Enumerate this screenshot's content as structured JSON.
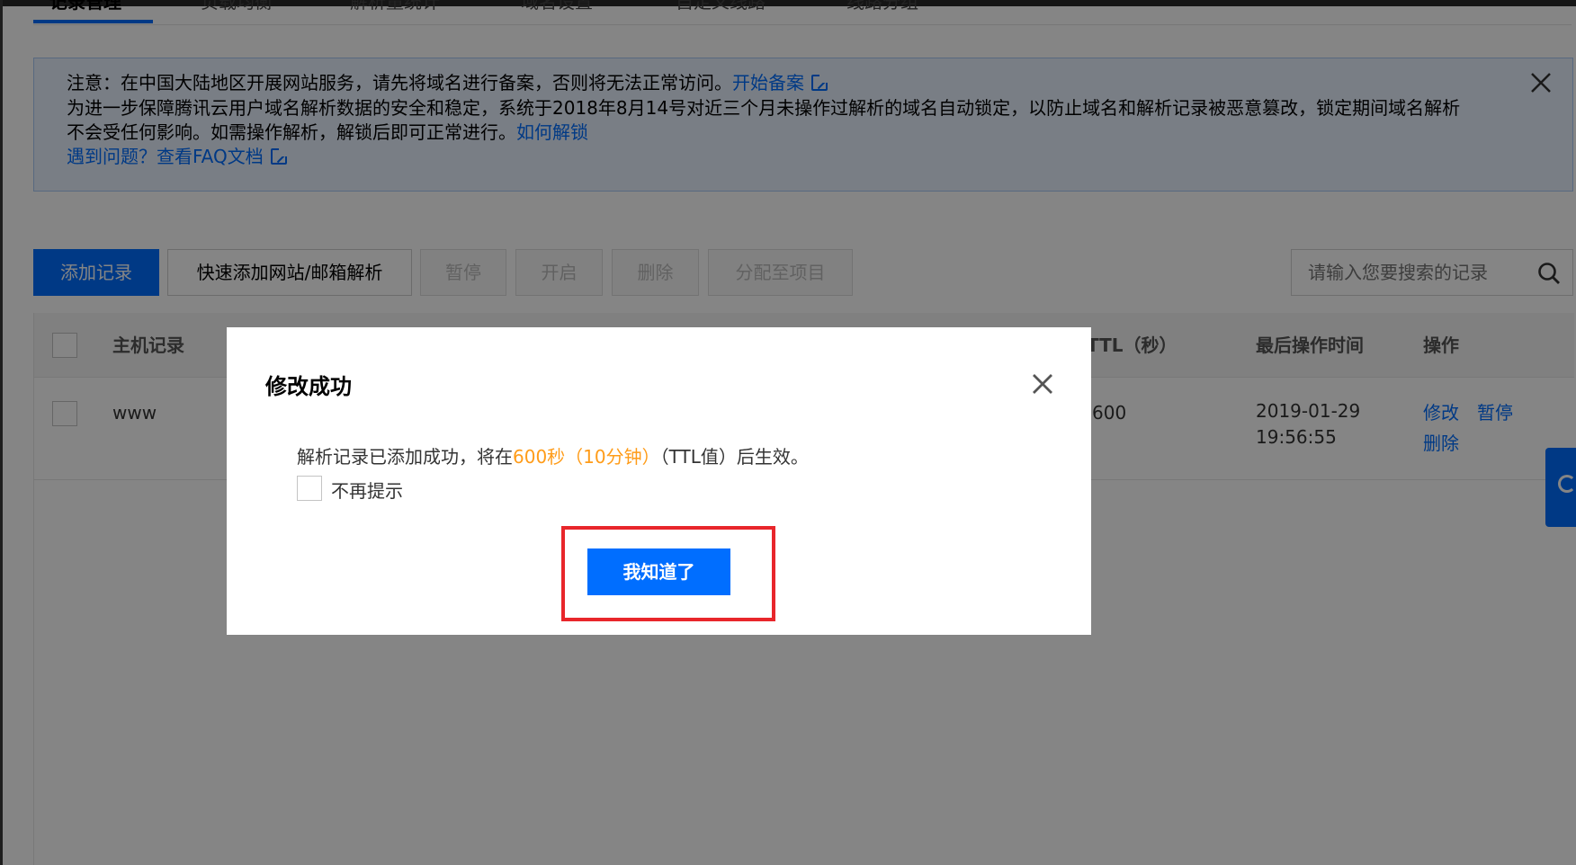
{
  "tabs": [
    {
      "label": "记录管理",
      "active": true
    },
    {
      "label": "负载均衡",
      "active": false
    },
    {
      "label": "解析量统计",
      "active": false
    },
    {
      "label": "域名设置",
      "active": false
    },
    {
      "label": "自定义线路",
      "active": false
    },
    {
      "label": "线路分组",
      "active": false
    }
  ],
  "notice": {
    "line1_text": "注意：在中国大陆地区开展网站服务，请先将域名进行备案，否则将无法正常访问。",
    "line1_link": "开始备案",
    "line2_text": "为进一步保障腾讯云用户域名解析数据的安全和稳定，系统于2018年8月14号对近三个月未操作过解析的域名自动锁定，以防止域名和解析记录被恶意篡改，锁定期间域名解析",
    "line3_text": "不会受任何影响。如需操作解析，解锁后即可正常进行。",
    "line3_link": "如何解锁",
    "line4_link": "遇到问题？查看FAQ文档",
    "close_icon": "close-icon"
  },
  "toolbar": {
    "add_record": "添加记录",
    "quick_add": "快速添加网站/邮箱解析",
    "pause": "暂停",
    "enable": "开启",
    "delete": "删除",
    "assign_project": "分配至项目",
    "search_placeholder": "请输入您要搜索的记录"
  },
  "table": {
    "headers": {
      "host": "主机记录",
      "ttl": "TTL（秒）",
      "last_op": "最后操作时间",
      "actions": "操作"
    },
    "rows": [
      {
        "host": "www",
        "ttl": "600",
        "last_op_date": "2019-01-29",
        "last_op_time": "19:56:55",
        "action_edit": "修改",
        "action_pause": "暂停",
        "action_delete": "删除"
      }
    ]
  },
  "modal": {
    "title": "修改成功",
    "message_prefix": "解析记录已添加成功，将在",
    "message_highlight": "600秒（10分钟）",
    "message_suffix": "（TTL值）后生效。",
    "dont_show_again": "不再提示",
    "ack_button": "我知道了"
  },
  "colors": {
    "primary": "#006eff",
    "highlight": "#ff9c19",
    "annotation_red": "#e8262b"
  }
}
